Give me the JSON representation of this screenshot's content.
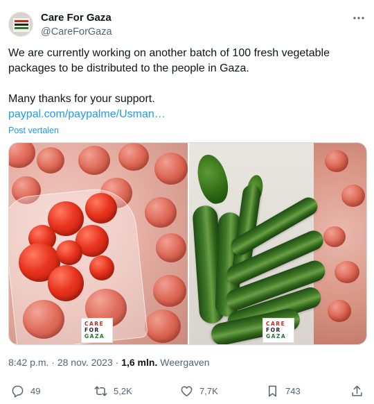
{
  "author": {
    "display_name": "Care For Gaza",
    "handle": "@CareForGaza",
    "avatar_lines": [
      "CARE",
      "FOR",
      "GAZA"
    ]
  },
  "tweet": {
    "text_line1": "We are currently working on another batch of 100 fresh vegetable",
    "text_line2": "packages to be distributed to the people in Gaza.",
    "text_thanks": "Many thanks for your support.",
    "link": "paypal.com/paypalme/Usman…",
    "translate": "Post vertalen"
  },
  "media": {
    "watermark_left": [
      "CARE",
      "FOR",
      "GAZA"
    ],
    "watermark_right": [
      "CARE",
      "FOR",
      "GAZA"
    ]
  },
  "meta": {
    "time": "8:42 p.m.",
    "separator1": " · ",
    "date": "28 nov. 2023",
    "separator2": " · ",
    "views_count": "1,6 mln.",
    "views_label": " Weergaven"
  },
  "actions": {
    "replies": "49",
    "reposts": "5,2K",
    "likes": "7,7K",
    "bookmarks": "743"
  },
  "icons": {
    "more": "more-horizontal-icon",
    "reply": "reply-icon",
    "repost": "repost-icon",
    "like": "heart-icon",
    "bookmark": "bookmark-icon",
    "share": "share-icon"
  },
  "colors": {
    "link": "#1d9bf0",
    "secondary_text": "#536471",
    "primary_text": "#0f1419"
  }
}
